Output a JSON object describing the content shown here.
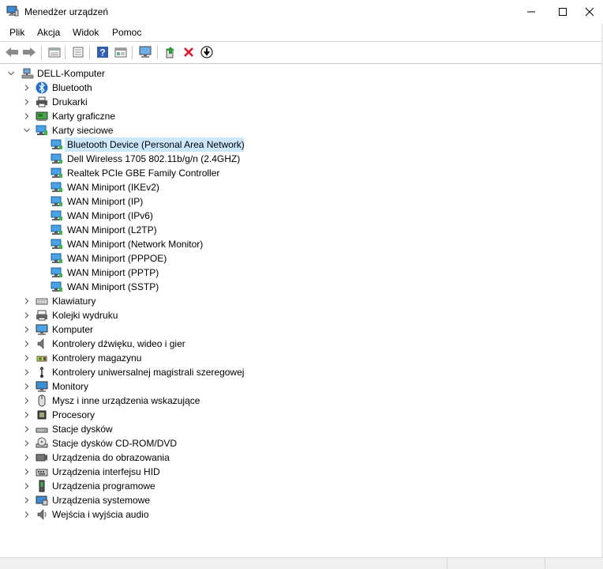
{
  "window": {
    "title": "Menedżer urządzeń"
  },
  "menu": [
    "Plik",
    "Akcja",
    "Widok",
    "Pomoc"
  ],
  "toolbar": [
    {
      "name": "back-button-icon"
    },
    {
      "name": "forward-button-icon"
    },
    {
      "name": "properties-view-icon"
    },
    {
      "name": "list-view-icon"
    },
    {
      "name": "help-icon"
    },
    {
      "name": "details-view-icon"
    },
    {
      "name": "monitor-scan-icon"
    },
    {
      "name": "update-driver-icon"
    },
    {
      "name": "uninstall-device-icon"
    },
    {
      "name": "download-icon"
    }
  ],
  "tree": {
    "root": "DELL-Komputer",
    "categories": [
      {
        "label": "Bluetooth",
        "icon": "bluetooth-icon",
        "expanded": false
      },
      {
        "label": "Drukarki",
        "icon": "printer-icon",
        "expanded": false
      },
      {
        "label": "Karty graficzne",
        "icon": "display-adapter-icon",
        "expanded": false
      },
      {
        "label": "Karty sieciowe",
        "icon": "network-adapter-icon",
        "expanded": true,
        "children": [
          "Bluetooth Device (Personal Area Network)",
          "Dell Wireless 1705 802.11b/g/n (2.4GHZ)",
          "Realtek PCIe GBE Family Controller",
          "WAN Miniport (IKEv2)",
          "WAN Miniport (IP)",
          "WAN Miniport (IPv6)",
          "WAN Miniport (L2TP)",
          "WAN Miniport (Network Monitor)",
          "WAN Miniport (PPPOE)",
          "WAN Miniport (PPTP)",
          "WAN Miniport (SSTP)"
        ]
      },
      {
        "label": "Klawiatury",
        "icon": "keyboard-icon",
        "expanded": false
      },
      {
        "label": "Kolejki wydruku",
        "icon": "print-queue-icon",
        "expanded": false
      },
      {
        "label": "Komputer",
        "icon": "computer-icon",
        "expanded": false
      },
      {
        "label": "Kontrolery dźwięku, wideo i gier",
        "icon": "speaker-icon",
        "expanded": false
      },
      {
        "label": "Kontrolery magazynu",
        "icon": "storage-controller-icon",
        "expanded": false
      },
      {
        "label": "Kontrolery uniwersalnej magistrali szeregowej",
        "icon": "usb-icon",
        "expanded": false
      },
      {
        "label": "Monitory",
        "icon": "monitor-icon",
        "expanded": false
      },
      {
        "label": "Mysz i inne urządzenia wskazujące",
        "icon": "mouse-icon",
        "expanded": false
      },
      {
        "label": "Procesory",
        "icon": "processor-icon",
        "expanded": false
      },
      {
        "label": "Stacje dysków",
        "icon": "disk-drive-icon",
        "expanded": false
      },
      {
        "label": "Stacje dysków CD-ROM/DVD",
        "icon": "cdrom-icon",
        "expanded": false
      },
      {
        "label": "Urządzenia do obrazowania",
        "icon": "camera-icon",
        "expanded": false
      },
      {
        "label": "Urządzenia interfejsu HID",
        "icon": "hid-icon",
        "expanded": false
      },
      {
        "label": "Urządzenia programowe",
        "icon": "software-device-icon",
        "expanded": false
      },
      {
        "label": "Urządzenia systemowe",
        "icon": "system-device-icon",
        "expanded": false
      },
      {
        "label": "Wejścia i wyjścia audio",
        "icon": "audio-io-icon",
        "expanded": false
      }
    ],
    "selected": "Bluetooth Device (Personal Area Network)"
  },
  "colors": {
    "selection": "#cce8ff",
    "monitor_blue": "#1e90e0",
    "uninstall_red": "#e81123"
  }
}
